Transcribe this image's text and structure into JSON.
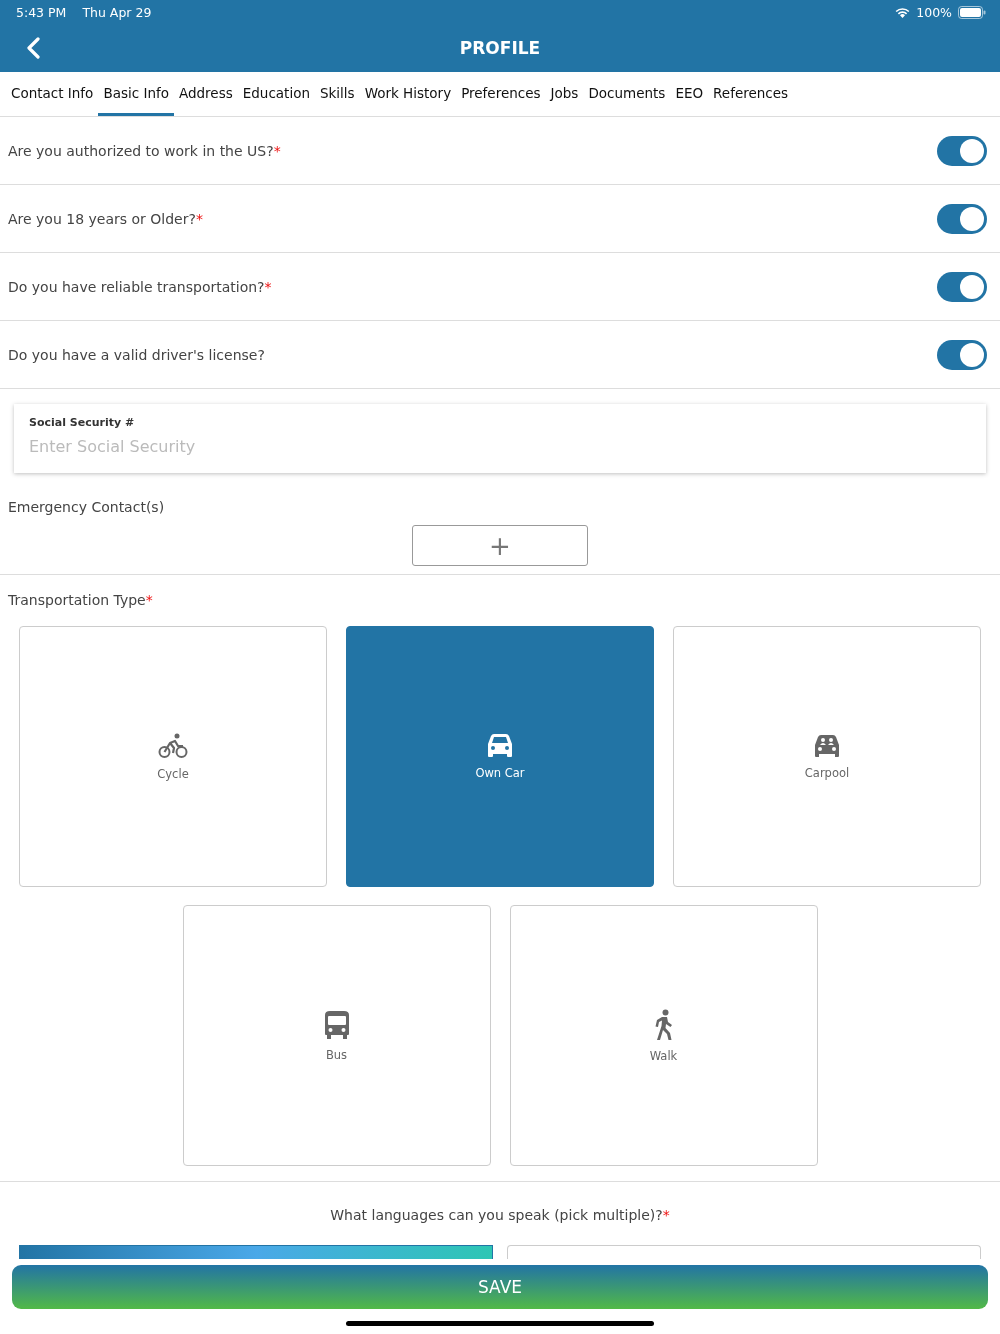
{
  "status_bar": {
    "time": "5:43 PM",
    "date": "Thu Apr 29",
    "battery": "100%"
  },
  "header": {
    "title": "PROFILE"
  },
  "tabs": [
    {
      "label": "Contact Info",
      "selected": false
    },
    {
      "label": "Basic Info",
      "selected": true
    },
    {
      "label": "Address",
      "selected": false
    },
    {
      "label": "Education",
      "selected": false
    },
    {
      "label": "Skills",
      "selected": false
    },
    {
      "label": "Work History",
      "selected": false
    },
    {
      "label": "Preferences",
      "selected": false
    },
    {
      "label": "Jobs",
      "selected": false
    },
    {
      "label": "Documents",
      "selected": false
    },
    {
      "label": "EEO",
      "selected": false
    },
    {
      "label": "References",
      "selected": false
    }
  ],
  "questions": [
    {
      "label": "Are you authorized to work in the US?",
      "required_mark": "*",
      "on": true
    },
    {
      "label": "Are you 18 years or Older?",
      "required_mark": "*",
      "on": true
    },
    {
      "label": "Do you have reliable transportation?",
      "required_mark": "*",
      "on": true
    },
    {
      "label": "Do you have a valid driver's license?",
      "on": true
    }
  ],
  "ssn_field": {
    "label": "Social Security #",
    "placeholder": "Enter Social Security"
  },
  "emergency_contacts": {
    "label": "Emergency Contact(s)",
    "add_button": "+"
  },
  "transportation": {
    "label": "Transportation Type",
    "required_mark": "*",
    "options": [
      {
        "kind": "cycle",
        "label": "Cycle",
        "selected": false
      },
      {
        "kind": "car",
        "label": "Own Car",
        "selected": true
      },
      {
        "kind": "carpool",
        "label": "Carpool",
        "selected": false
      },
      {
        "kind": "bus",
        "label": "Bus",
        "selected": false
      },
      {
        "kind": "walk",
        "label": "Walk",
        "selected": false
      }
    ]
  },
  "languages": {
    "label": "What languages can you speak (pick multiple)?",
    "required_mark": "*",
    "options": [
      {
        "selected": true
      },
      {
        "selected": false
      }
    ]
  },
  "save_button": "SAVE"
}
